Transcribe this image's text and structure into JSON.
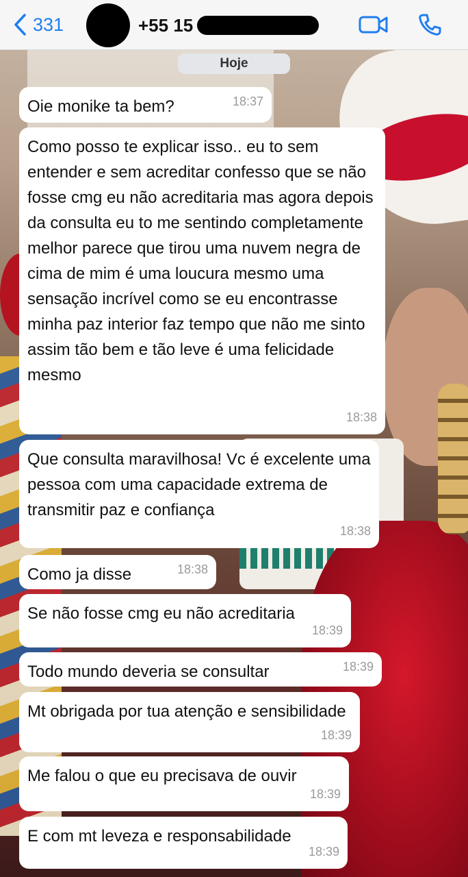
{
  "header": {
    "back_count": "331",
    "contact_number": "+55 15",
    "back_icon": "chevron-left-icon",
    "video_icon": "video-camera-icon",
    "call_icon": "phone-icon"
  },
  "chat": {
    "date_label": "Hoje",
    "messages": [
      {
        "text": "Oie monike ta bem?",
        "time": "18:37"
      },
      {
        "text": "Como posso te explicar isso.. eu to sem entender e sem acreditar confesso que se não fosse cmg eu não acreditaria mas agora depois da consulta eu to me sentindo completamente melhor parece que tirou uma nuvem negra de cima de mim é uma loucura mesmo uma sensação incrível como se eu encontrasse minha paz interior faz tempo que não me sinto assim tão bem e tão leve é uma felicidade mesmo",
        "time": "18:38"
      },
      {
        "text": "Que consulta maravilhosa! Vc é excelente uma pessoa com uma capacidade extrema de transmitir paz e confiança",
        "time": "18:38"
      },
      {
        "text": "Como ja disse",
        "time": "18:38"
      },
      {
        "text": "Se não fosse cmg eu não acreditaria",
        "time": "18:39"
      },
      {
        "text": "Todo mundo deveria se consultar",
        "time": "18:39"
      },
      {
        "text": "Mt obrigada por tua atenção e sensibilidade",
        "time": "18:39"
      },
      {
        "text": "Me falou o que eu precisava de ouvir",
        "time": "18:39"
      },
      {
        "text": "E com mt leveza e responsabilidade",
        "time": "18:39"
      }
    ]
  },
  "colors": {
    "accent": "#1f7ef1",
    "bubble": "#ffffff",
    "header_bg": "#f6f6f6",
    "timestamp": "#9a9a9a"
  }
}
